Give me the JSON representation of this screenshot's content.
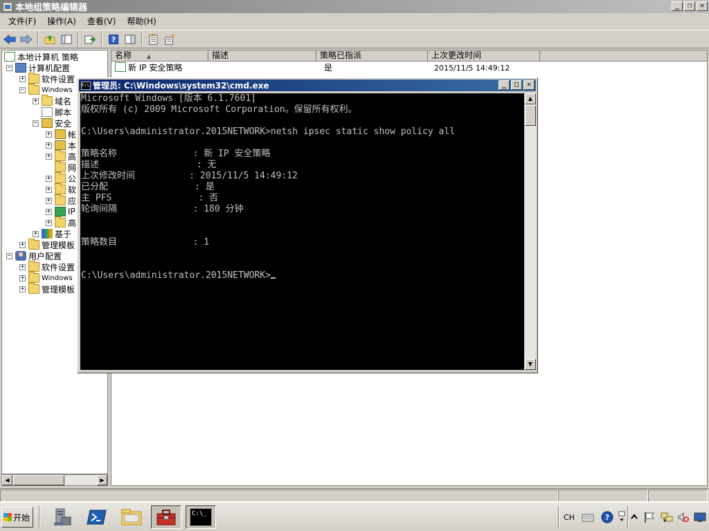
{
  "window": {
    "title": "本地组策略编辑器",
    "controls": {
      "minimize": "_",
      "restore": "❐",
      "close": "✕"
    }
  },
  "menu": [
    "文件(F)",
    "操作(A)",
    "查看(V)",
    "帮助(H)"
  ],
  "toolbar_icons": [
    "back-icon",
    "forward-icon",
    "up-folder-icon",
    "show-hide-tree-icon",
    "export-list-icon",
    "help-icon",
    "properties-pane-icon",
    "properties-icon",
    "filter-options-icon"
  ],
  "tree": {
    "root": "本地计算机 策略",
    "computer_config": "计算机配置",
    "software_settings_1": "软件设置",
    "windows_settings_1": "Windows",
    "name_resolution": "域名",
    "scripts": "脚本",
    "security_settings": "安全",
    "account_policies": "帐",
    "local_policies": "本",
    "advanced_firewall": "高",
    "network_list": "网",
    "public_key": "公",
    "software_restriction": "软",
    "app_control": "应",
    "ip_security": "IP",
    "advanced_audit": "高",
    "policy_qos": "基于",
    "admin_templates_1": "管理模板",
    "user_config": "用户配置",
    "software_settings_2": "软件设置",
    "windows_settings_2": "Windows",
    "admin_templates_2": "管理模板"
  },
  "list": {
    "columns": {
      "name": "名称",
      "description": "描述",
      "assigned": "策略已指派",
      "modified": "上次更改时间"
    },
    "rows": [
      {
        "name": "新 IP 安全策略",
        "description": "",
        "assigned": "是",
        "modified": "2015/11/5 14:49:12"
      }
    ]
  },
  "cmd": {
    "title": "管理员: C:\\Windows\\system32\\cmd.exe",
    "icon_text": "C:\\",
    "lines": [
      "Microsoft Windows [版本 6.1.7601]",
      "版权所有 (c) 2009 Microsoft Corporation。保留所有权利。",
      "",
      "C:\\Users\\administrator.2015NETWORK>netsh ipsec static show policy all",
      "",
      "策略名称              : 新 IP 安全策略",
      "描述                  : 无",
      "上次修改时间          : 2015/11/5 14:49:12",
      "已分配                : 是",
      "主 PFS                : 否",
      "轮询间隔              : 180 分钟",
      "",
      "",
      "策略数目              : 1",
      "",
      "",
      "C:\\Users\\administrator.2015NETWORK>"
    ]
  },
  "taskbar": {
    "start_label": "开始",
    "apps": [
      "server-manager-icon",
      "powershell-icon",
      "explorer-icon",
      "toolbox-icon",
      "cmd-icon"
    ],
    "cmd_icon_text": "C:\\_",
    "lang": "CH"
  }
}
